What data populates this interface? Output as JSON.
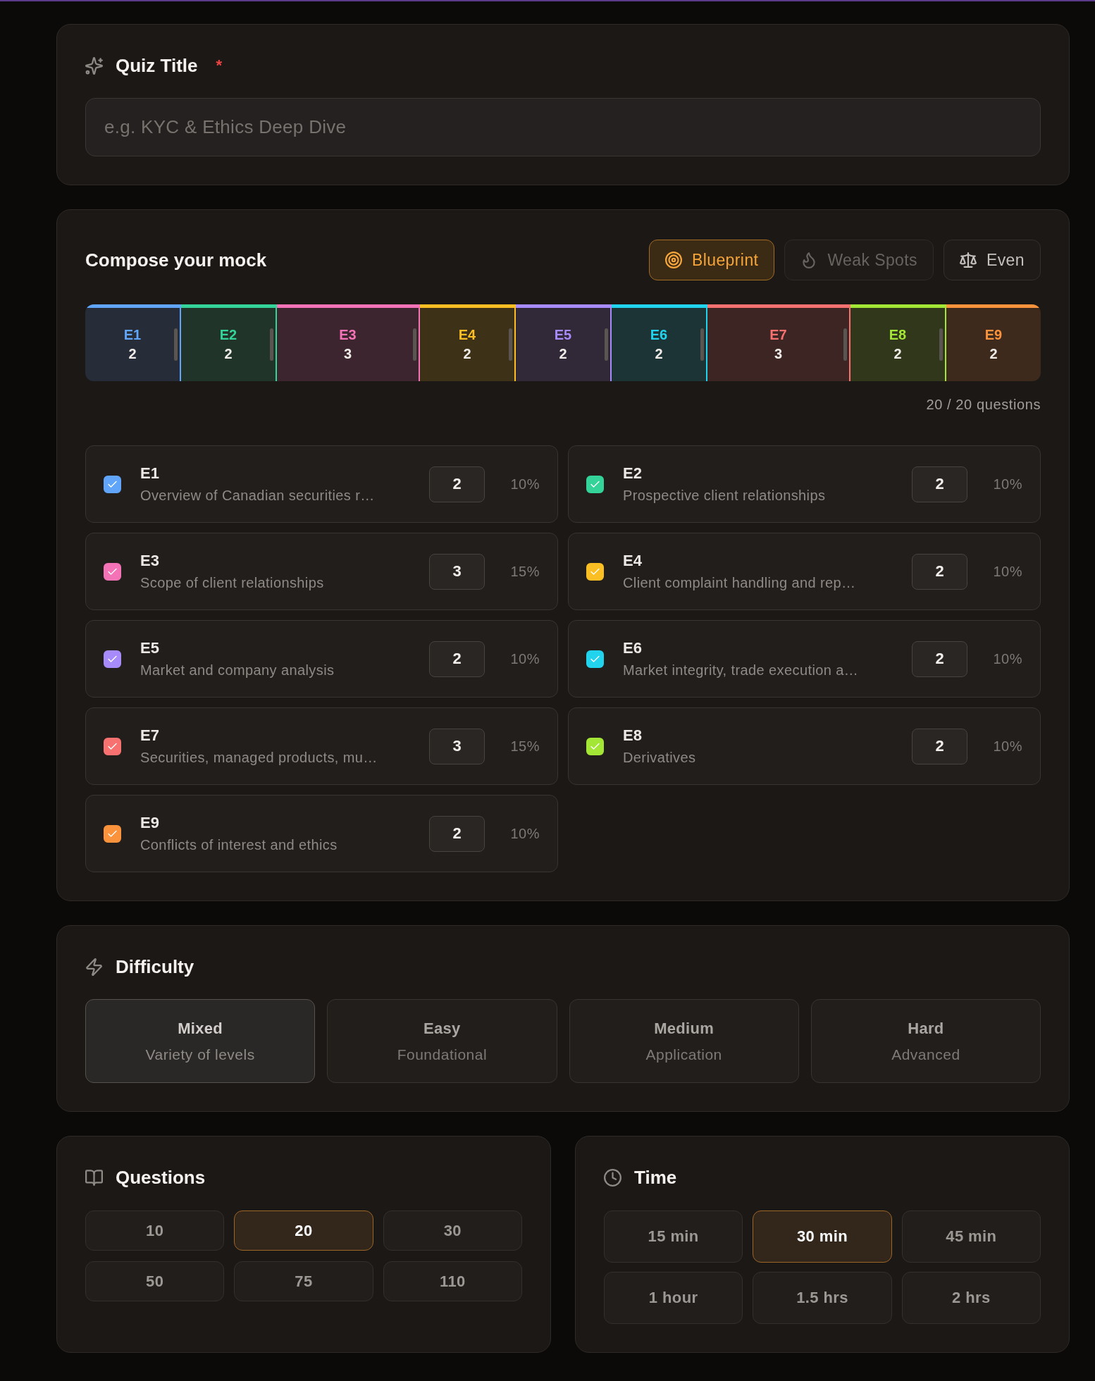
{
  "quiz_title": {
    "label": "Quiz Title",
    "required_mark": "*",
    "placeholder": "e.g. KYC & Ethics Deep Dive"
  },
  "compose": {
    "title": "Compose your mock",
    "modes": [
      {
        "label": "Blueprint",
        "selected": true,
        "disabled": false
      },
      {
        "label": "Weak Spots",
        "selected": false,
        "disabled": true
      },
      {
        "label": "Even",
        "selected": false,
        "disabled": false
      }
    ],
    "segments": [
      {
        "label": "E1",
        "count": "2",
        "color": "#60a5fa"
      },
      {
        "label": "E2",
        "count": "2",
        "color": "#34d399"
      },
      {
        "label": "E3",
        "count": "3",
        "color": "#f472b6"
      },
      {
        "label": "E4",
        "count": "2",
        "color": "#fbbf24"
      },
      {
        "label": "E5",
        "count": "2",
        "color": "#a78bfa"
      },
      {
        "label": "E6",
        "count": "2",
        "color": "#22d3ee"
      },
      {
        "label": "E7",
        "count": "3",
        "color": "#f87171"
      },
      {
        "label": "E8",
        "count": "2",
        "color": "#a3e635"
      },
      {
        "label": "E9",
        "count": "2",
        "color": "#fb923c"
      }
    ],
    "summary": "20 / 20 questions",
    "topics": [
      {
        "code": "E1",
        "description": "Overview of Canadian securities r…",
        "count": "2",
        "percent": "10%",
        "checked": true,
        "color": "#60a5fa"
      },
      {
        "code": "E2",
        "description": "Prospective client relationships",
        "count": "2",
        "percent": "10%",
        "checked": true,
        "color": "#34d399"
      },
      {
        "code": "E3",
        "description": "Scope of client relationships",
        "count": "3",
        "percent": "15%",
        "checked": true,
        "color": "#f472b6"
      },
      {
        "code": "E4",
        "description": "Client complaint handling and rep…",
        "count": "2",
        "percent": "10%",
        "checked": true,
        "color": "#fbbf24"
      },
      {
        "code": "E5",
        "description": "Market and company analysis",
        "count": "2",
        "percent": "10%",
        "checked": true,
        "color": "#a78bfa"
      },
      {
        "code": "E6",
        "description": "Market integrity, trade execution a…",
        "count": "2",
        "percent": "10%",
        "checked": true,
        "color": "#22d3ee"
      },
      {
        "code": "E7",
        "description": "Securities, managed products, mu…",
        "count": "3",
        "percent": "15%",
        "checked": true,
        "color": "#f87171"
      },
      {
        "code": "E8",
        "description": "Derivatives",
        "count": "2",
        "percent": "10%",
        "checked": true,
        "color": "#a3e635"
      },
      {
        "code": "E9",
        "description": "Conflicts of interest and ethics",
        "count": "2",
        "percent": "10%",
        "checked": true,
        "color": "#fb923c"
      }
    ]
  },
  "difficulty": {
    "title": "Difficulty",
    "options": [
      {
        "label": "Mixed",
        "description": "Variety of levels",
        "selected": true
      },
      {
        "label": "Easy",
        "description": "Foundational",
        "selected": false
      },
      {
        "label": "Medium",
        "description": "Application",
        "selected": false
      },
      {
        "label": "Hard",
        "description": "Advanced",
        "selected": false
      }
    ]
  },
  "questions": {
    "title": "Questions",
    "options": [
      {
        "label": "10",
        "selected": false
      },
      {
        "label": "20",
        "selected": true
      },
      {
        "label": "30",
        "selected": false
      },
      {
        "label": "50",
        "selected": false
      },
      {
        "label": "75",
        "selected": false
      },
      {
        "label": "110",
        "selected": false
      }
    ]
  },
  "time": {
    "title": "Time",
    "options": [
      {
        "label": "15 min",
        "selected": false
      },
      {
        "label": "30 min",
        "selected": true
      },
      {
        "label": "45 min",
        "selected": false
      },
      {
        "label": "1 hour",
        "selected": false
      },
      {
        "label": "1.5 hrs",
        "selected": false
      },
      {
        "label": "2 hrs",
        "selected": false
      }
    ]
  }
}
